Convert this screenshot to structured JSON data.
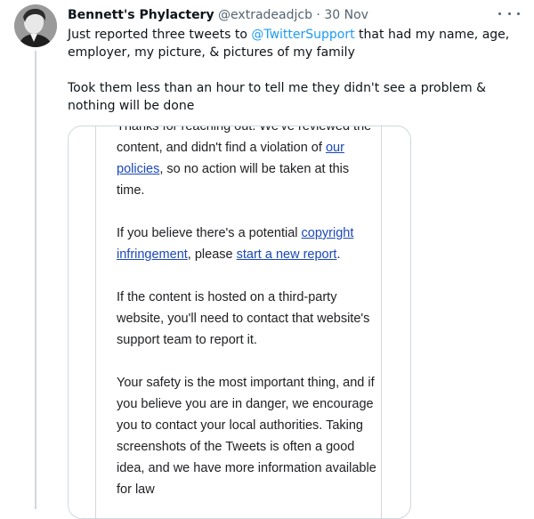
{
  "tweet": {
    "author_name": "Bennett's Phylactery",
    "handle": "@extradeadjcb",
    "separator": "·",
    "date": "30 Nov",
    "more_icon": "more-horizontal-icon",
    "text_p1_a": "Just reported three tweets to ",
    "text_p1_mention": "@TwitterSupport",
    "text_p1_b": " that had my name, age, employer, my picture, & pictures of my family",
    "text_p2": "Took them less than an hour to tell me they didn't see a problem & nothing will be done"
  },
  "email": {
    "p1_a": "Thanks for reaching out. We've reviewed the content, and didn't find a violation of ",
    "p1_link": "our policies",
    "p1_b": ", so no action will be taken at this time.",
    "p2_a": "If you believe there's a potential ",
    "p2_link1": "copyright infringement",
    "p2_b": ", please ",
    "p2_link2": "start a new report",
    "p2_c": ".",
    "p3": "If the content is hosted on a third-party website, you'll need to contact that website's support team to report it.",
    "p4": "Your safety is the most important thing, and if you believe you are in danger, we encourage you to contact your local authorities. Taking screenshots of the Tweets is often a good idea, and we have more information available for law"
  }
}
